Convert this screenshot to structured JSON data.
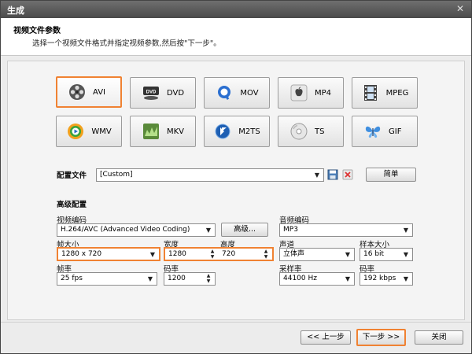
{
  "window": {
    "title": "生成"
  },
  "header": {
    "title": "视频文件参数",
    "subtitle": "选择一个视频文件格式并指定视频参数,然后按\"下一步\"。"
  },
  "formats": [
    {
      "label": "AVI",
      "icon": "film-reel-icon",
      "selected": true
    },
    {
      "label": "DVD",
      "icon": "dvd-disc-icon",
      "selected": false
    },
    {
      "label": "MOV",
      "icon": "quicktime-icon",
      "selected": false
    },
    {
      "label": "MP4",
      "icon": "apple-icon",
      "selected": false
    },
    {
      "label": "MPEG",
      "icon": "film-strip-icon",
      "selected": false
    },
    {
      "label": "WMV",
      "icon": "windows-media-icon",
      "selected": false
    },
    {
      "label": "MKV",
      "icon": "mkv-icon",
      "selected": false
    },
    {
      "label": "M2TS",
      "icon": "bluray-icon",
      "selected": false
    },
    {
      "label": "TS",
      "icon": "disc-icon",
      "selected": false
    },
    {
      "label": "GIF",
      "icon": "butterfly-icon",
      "selected": false
    }
  ],
  "profile": {
    "label": "配置文件",
    "value": "[Custom]",
    "simple_button": "简单"
  },
  "advanced": {
    "section_title": "高级配置",
    "video_codec_label": "视频编码",
    "video_codec_value": "H.264/AVC (Advanced Video Coding)",
    "advanced_button": "高级...",
    "audio_codec_label": "音频编码",
    "audio_codec_value": "MP3",
    "frame_size_label": "帧大小",
    "frame_size_value": "1280 x 720",
    "width_label": "宽度",
    "width_value": "1280",
    "height_label": "高度",
    "height_value": "720",
    "channels_label": "声道",
    "channels_value": "立体声",
    "sample_size_label": "样本大小",
    "sample_size_value": "16 bit",
    "frame_rate_label": "帧率",
    "frame_rate_value": "25 fps",
    "bitrate_label": "码率",
    "bitrate_value": "1200",
    "sample_rate_label": "采样率",
    "sample_rate_value": "44100 Hz",
    "audio_bitrate_label": "码率",
    "audio_bitrate_value": "192 kbps"
  },
  "footer": {
    "back_button": "<< 上一步",
    "next_button": "下一步 >>",
    "close_button": "关闭"
  },
  "colors": {
    "highlight": "#f08232",
    "titlebar": "#5a5a5a"
  }
}
